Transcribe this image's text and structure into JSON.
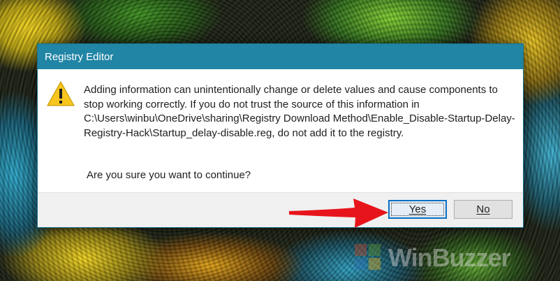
{
  "window": {
    "title": "Registry Editor"
  },
  "dialog": {
    "icon": "warning-icon",
    "message": "Adding information can unintentionally change or delete values and cause components to stop working correctly. If you do not trust the source of this information in C:\\Users\\winbu\\OneDrive\\sharing\\Registry Download Method\\Enable_Disable-Startup-Delay-Registry-Hack\\Startup_delay-disable.reg, do not add it to the registry.",
    "question": "Are you sure you want to continue?",
    "buttons": {
      "yes_label": "Yes",
      "no_label": "No"
    }
  },
  "watermark": {
    "text": "WinBuzzer"
  },
  "colors": {
    "titlebar": "#2185a5",
    "annotation_arrow": "#e8141b",
    "warning_icon": "#f7c51e"
  }
}
